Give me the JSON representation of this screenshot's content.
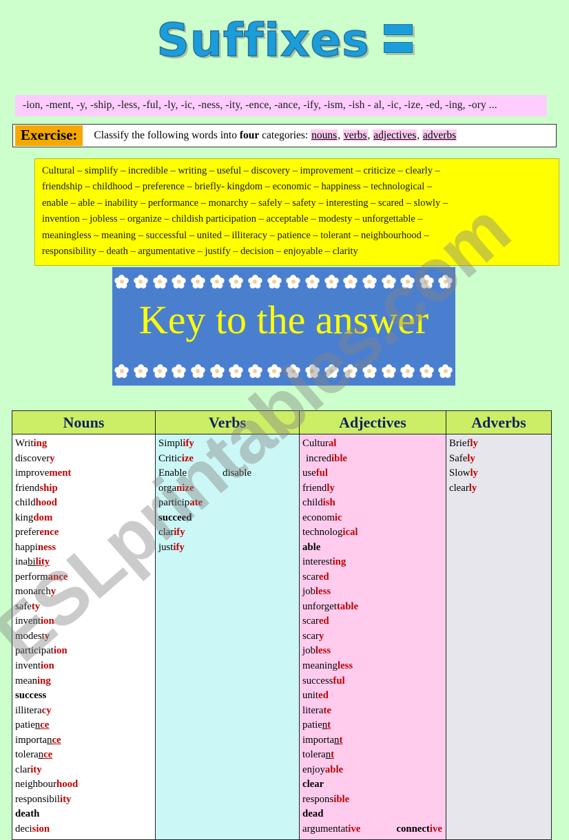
{
  "title": {
    "text": "Suffixes",
    "equals_symbol": "="
  },
  "suffix_strip": {
    "text": "-ion, -ment, -y, -ship, -less, -ful, -ly, -ic, -ness, -ity, -ence,  -ance, -ify, -ism, -ish - al, -ic, -ize, -ed, -ing, -ory ..."
  },
  "exercise": {
    "label": "Exercise:",
    "instruction_part1": "Classify the following words into ",
    "instruction_bold": "four",
    "instruction_part2": " categories: ",
    "categories": [
      "nouns",
      "verbs",
      "adjectives",
      "adverbs"
    ],
    "separator": ", "
  },
  "word_bank": {
    "lines": [
      "Cultural – simplify – incredible – writing – useful – discovery – improvement – criticize – clearly –",
      "friendship – childhood – preference – briefly- kingdom – economic – happiness – technological –",
      "enable – able – inability – performance – monarchy – safely – safety – interesting – scared – slowly –",
      "invention – jobless – organize – childish participation –   acceptable – modesty  – unforgettable –",
      "meaningless – meaning – successful – united –   illiteracy – patience – tolerant – neighbourhood –",
      "responsibility – death – argumentative – justify – decision – enjoyable – clarity"
    ]
  },
  "key_banner": {
    "text": "Key to the answer",
    "background_color": "#4a7fd0",
    "text_color": "#ffff00"
  },
  "answer_table": {
    "headers": [
      "Nouns",
      "Verbs",
      "Adjectives",
      "Adverbs"
    ],
    "columns": {
      "nouns": [
        "Writing",
        "discovery",
        "improvement",
        "friendship",
        "childhood",
        "kingdom",
        "preference",
        "happiness",
        "inability",
        "performance",
        "monarchy",
        "safety",
        "invention",
        "modesty",
        "participation",
        "invention",
        "meaning",
        "success",
        "illiteracy",
        "patience",
        "importance",
        "tolerance",
        "clarity",
        "neighbourhood",
        "responsibility",
        "death",
        "decision"
      ],
      "verbs": [
        "Simplify",
        "Criticize",
        "Enable        disable",
        "organize",
        "participate",
        "succeed",
        "clarify",
        "justify"
      ],
      "adjectives": [
        "Cultural",
        "incredible",
        "useful",
        "friendly",
        "childish",
        "economic",
        "technological",
        "able",
        "interesting",
        "scared",
        "jobless",
        "unforgettable",
        "scared",
        "scary",
        "jobless",
        "meaningless",
        "successful",
        "united",
        "literate",
        "patient",
        "important",
        "tolerant",
        "enjoyable",
        "clear",
        "responsible",
        "dead",
        "argumentative    connective"
      ],
      "adverbs": [
        "Briefly",
        "Safely",
        "Slowly",
        "clearly"
      ]
    }
  },
  "watermark": {
    "text": "ESLprintables.com"
  },
  "colors": {
    "page_background": "#ccffcc",
    "suffix_strip": "#ffccff",
    "word_bank": "#ffff00",
    "exercise_label": "#f5a800",
    "header_row": "#ccee66",
    "header_text": "#12225c",
    "suffix_highlight": "#c00000",
    "title_blue": "#1a9edb",
    "nouns_cell": "#ffffff",
    "verbs_cell": "#ccf7f7",
    "adjectives_cell": "#ffccee",
    "adverbs_cell": "#e6e6ec"
  }
}
